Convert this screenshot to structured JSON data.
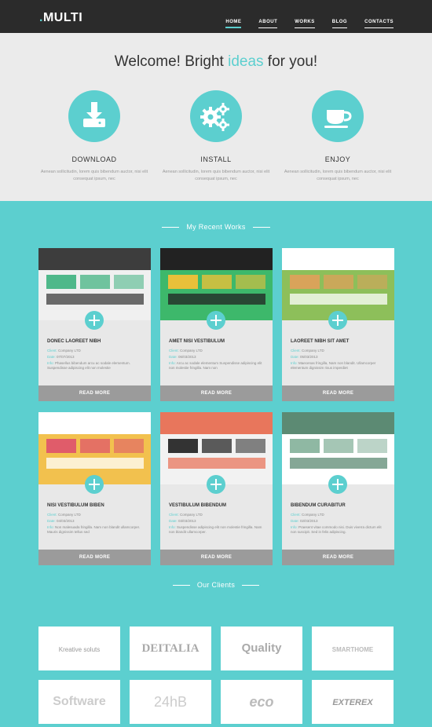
{
  "header": {
    "logo_dot": ".",
    "logo_text": "MULTI",
    "nav": [
      "HOME",
      "ABOUT",
      "WORKS",
      "BLOG",
      "CONTACTS"
    ]
  },
  "welcome": {
    "title_pre": "Welcome! Bright ",
    "title_hl": "ideas",
    "title_post": " for you!",
    "features": [
      {
        "title": "DOWNLOAD",
        "icon": "download-icon",
        "text": "Aenean sollicitudin, lorem quis bibendum auctor, nisi elit consequat ipsum, nec"
      },
      {
        "title": "INSTALL",
        "icon": "gears-icon",
        "text": "Aenean sollicitudin, lorem quis bibendum auctor, nisi elit consequat ipsum, nec"
      },
      {
        "title": "ENJOY",
        "icon": "cup-icon",
        "text": "Aenean sollicitudin, lorem quis bibendum auctor, nisi elit consequat ipsum, nec"
      }
    ]
  },
  "works": {
    "heading": "My Recent Works",
    "read_more": "READ MORE",
    "client_label": "Client:",
    "date_label": "Date:",
    "info_label": "Info:",
    "items": [
      {
        "title": "DONEC LAOREET NIBH",
        "client": "Company LTD",
        "date": "07/07/2013",
        "info": "Phasellus bibendum arcu ac sodale elementum. Suspendisse adipiscing elit non molestie",
        "thumb_colors": [
          "#3d3d3d",
          "#4fb88a",
          "#f0f0f0"
        ]
      },
      {
        "title": "AMET NISI VESTIBULUM",
        "client": "Company LTD",
        "date": "06/03/2013",
        "info": "Arcu ac sodale elementum Suspendisse adipiscing elit non molestie fringilla. Nam non",
        "thumb_colors": [
          "#222222",
          "#e9c03a",
          "#3db86b"
        ]
      },
      {
        "title": "LAOREET NIBH SIT AMET",
        "client": "Company LTD",
        "date": "05/03/2013",
        "info": "Maecenas fringilla, Nam non blandit. Ullamcorper elementum dignissim risus imperdiet",
        "thumb_colors": [
          "#ffffff",
          "#d9a35a",
          "#8dbf5a"
        ]
      },
      {
        "title": "NISI VESTIBULUM BIBEN",
        "client": "Company LTD",
        "date": "04/03/2013",
        "info": "Non malesuada fringilla. Nam non blandit ullamcorper. Mauris dignissim tellus sed",
        "thumb_colors": [
          "#ffffff",
          "#e05c6a",
          "#f2c14e"
        ]
      },
      {
        "title": "VESTIBULUM BIBENDUM",
        "client": "Company LTD",
        "date": "03/03/2013",
        "info": "Suspendisse adipiscing elit non molestie fringilla. Nam non blandit ullamcorper.",
        "thumb_colors": [
          "#e8765c",
          "#333333",
          "#f2f2f2"
        ]
      },
      {
        "title": "BIBENDUM CURABITUR",
        "client": "Company LTD",
        "date": "02/03/2013",
        "info": "Praesent vitae commodo nisi. Duis viverra dictum elit non suscipit. Sed in felis adipiscing.",
        "thumb_colors": [
          "#5c8a73",
          "#8fb8a3",
          "#ffffff"
        ]
      }
    ]
  },
  "clients": {
    "heading": "Our Clients",
    "logos": [
      "Kreative soluts",
      "DEITALIA",
      "Quality",
      "SMARTHOME",
      "Software",
      "24hB",
      "eco",
      "EXTEREX"
    ]
  },
  "colors": {
    "accent": "#5ccfcf",
    "header_bg": "#2b2b2b",
    "light_bg": "#ebebeb"
  }
}
